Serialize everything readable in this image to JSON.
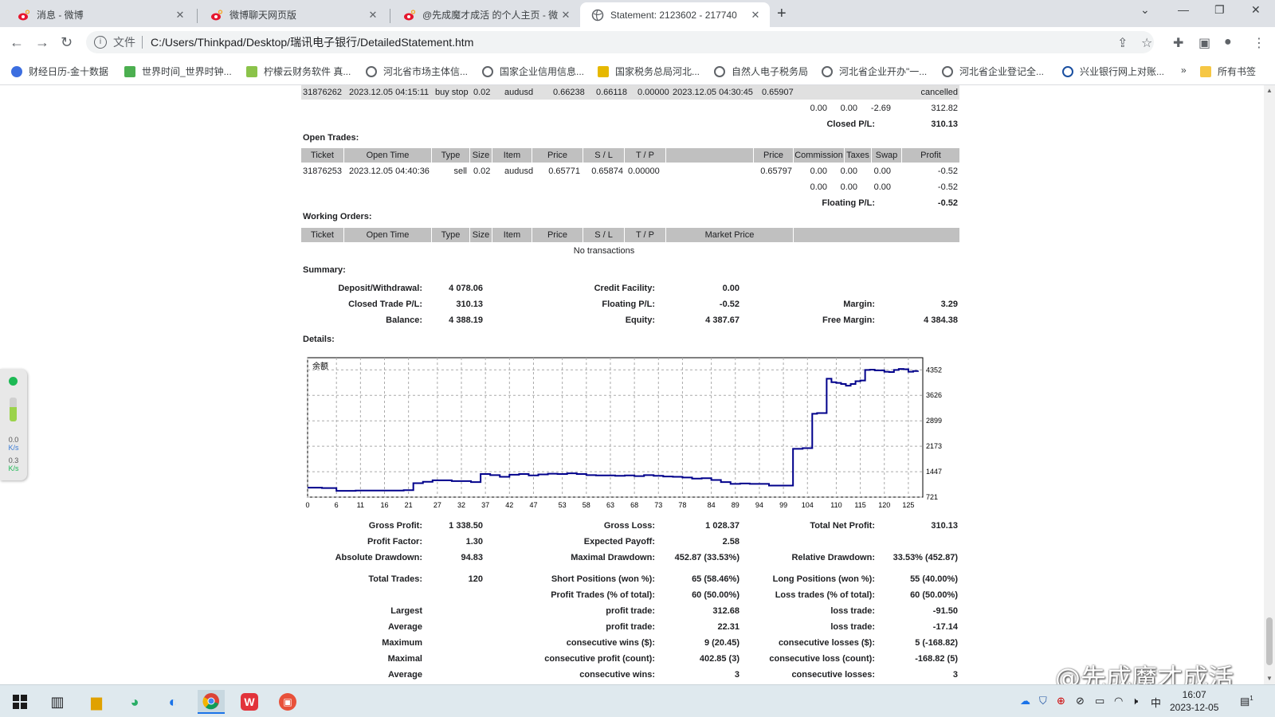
{
  "tabs": [
    {
      "title": "消息 - 微博",
      "icon": "weibo-icon"
    },
    {
      "title": "微博聊天网页版",
      "icon": "weibo-icon"
    },
    {
      "title": "@先成魔才成活 的个人主页 - 微",
      "icon": "weibo-icon"
    },
    {
      "title": "Statement: 2123602 - 217740",
      "icon": "globe-icon"
    }
  ],
  "address": {
    "file_label": "文件",
    "url": "C:/Users/Thinkpad/Desktop/瑞讯电子银行/DetailedStatement.htm"
  },
  "bookmarks": [
    {
      "label": "财经日历-金十数据",
      "color": "#3c6ee0"
    },
    {
      "label": "世界时间_世界时钟...",
      "color": "#4caf50"
    },
    {
      "label": "柠檬云财务软件 真...",
      "color": "#8bc34a"
    },
    {
      "label": "河北省市场主体信...",
      "color": "#5f6368"
    },
    {
      "label": "国家企业信用信息...",
      "color": "#5f6368"
    },
    {
      "label": "国家税务总局河北...",
      "color": "#e6b800"
    },
    {
      "label": "自然人电子税务局",
      "color": "#5f6368"
    },
    {
      "label": "河北省企业开办\"一...",
      "color": "#5f6368"
    },
    {
      "label": "河北省企业登记全...",
      "color": "#5f6368"
    },
    {
      "label": "兴业银行网上对账...",
      "color": "#1a4fa0"
    }
  ],
  "bookmarks_more": "»",
  "bookmarks_folder": "所有书签",
  "cancelled_row": {
    "ticket": "31876262",
    "time": "2023.12.05 04:15:11",
    "type": "buy stop",
    "size": "0.02",
    "item": "audusd",
    "price": "0.66238",
    "sl": "0.66118",
    "tp": "0.00000",
    "time2": "2023.12.05 04:30:45",
    "price2": "0.65907",
    "status": "cancelled"
  },
  "closed_totals": {
    "commission": "0.00",
    "taxes": "0.00",
    "swap": "-2.69",
    "profit": "312.82",
    "pl_label": "Closed P/L:",
    "pl_value": "310.13"
  },
  "open_trades": {
    "title": "Open Trades:",
    "headers": [
      "Ticket",
      "Open Time",
      "Type",
      "Size",
      "Item",
      "Price",
      "S / L",
      "T / P",
      "",
      "Price",
      "Commission",
      "Taxes",
      "Swap",
      "Profit"
    ],
    "row": {
      "ticket": "31876253",
      "time": "2023.12.05 04:40:36",
      "type": "sell",
      "size": "0.02",
      "item": "audusd",
      "price": "0.65771",
      "sl": "0.65874",
      "tp": "0.00000",
      "price2": "0.65797",
      "commission": "0.00",
      "taxes": "0.00",
      "swap": "0.00",
      "profit": "-0.52"
    },
    "totals": {
      "commission": "0.00",
      "taxes": "0.00",
      "swap": "0.00",
      "profit": "-0.52"
    },
    "floating_label": "Floating P/L:",
    "floating_value": "-0.52"
  },
  "working_orders": {
    "title": "Working Orders:",
    "headers": [
      "Ticket",
      "Open Time",
      "Type",
      "Size",
      "Item",
      "Price",
      "S / L",
      "T / P",
      "Market Price",
      ""
    ],
    "empty": "No transactions"
  },
  "summary": {
    "title": "Summary:",
    "deposit_label": "Deposit/Withdrawal:",
    "deposit": "4 078.06",
    "credit_label": "Credit Facility:",
    "credit": "0.00",
    "closed_label": "Closed Trade P/L:",
    "closed": "310.13",
    "floating_label": "Floating P/L:",
    "floating": "-0.52",
    "margin_label": "Margin:",
    "margin": "3.29",
    "balance_label": "Balance:",
    "balance": "4 388.19",
    "equity_label": "Equity:",
    "equity": "4 387.67",
    "free_margin_label": "Free Margin:",
    "free_margin": "4 384.38"
  },
  "details_title": "Details:",
  "chart_data": {
    "type": "line",
    "title": "",
    "corner_label": "余额",
    "xlabel": "",
    "ylabel": "",
    "x_ticks": [
      "0",
      "6",
      "11",
      "16",
      "21",
      "27",
      "32",
      "37",
      "42",
      "47",
      "53",
      "58",
      "63",
      "68",
      "73",
      "78",
      "84",
      "89",
      "94",
      "99",
      "104",
      "110",
      "115",
      "120",
      "125"
    ],
    "y_ticks": [
      "4352",
      "3626",
      "2899",
      "2173",
      "1447",
      "721"
    ],
    "ylim": [
      721,
      4700
    ],
    "xlim": [
      0,
      128
    ],
    "grid": true,
    "line_color": "#00008b",
    "series": [
      {
        "x": [
          0,
          3,
          6,
          8,
          10,
          14,
          20,
          22,
          24,
          26,
          30,
          34,
          36,
          38,
          40,
          42,
          44,
          46,
          48,
          50,
          52,
          54,
          56,
          58,
          60,
          62,
          64,
          66,
          68,
          70,
          72,
          74,
          76,
          78,
          80,
          82,
          84,
          86,
          88,
          90,
          92,
          94,
          96,
          100,
          101,
          103,
          104,
          105,
          106,
          107,
          108,
          109,
          110,
          111,
          112,
          113,
          114,
          115,
          116,
          117,
          118,
          119,
          120,
          121,
          122,
          123,
          124,
          125,
          126,
          127
        ],
        "y": [
          990,
          980,
          900,
          900,
          910,
          910,
          920,
          1120,
          1160,
          1200,
          1180,
          1150,
          1380,
          1350,
          1300,
          1360,
          1380,
          1340,
          1370,
          1390,
          1380,
          1400,
          1380,
          1350,
          1340,
          1340,
          1330,
          1340,
          1320,
          1350,
          1330,
          1310,
          1300,
          1280,
          1250,
          1260,
          1210,
          1150,
          1100,
          1110,
          1100,
          1100,
          1050,
          1050,
          2100,
          2120,
          2120,
          3100,
          3120,
          3120,
          4100,
          4000,
          3980,
          3950,
          3900,
          3950,
          4030,
          4050,
          4350,
          4360,
          4340,
          4340,
          4300,
          4290,
          4350,
          4380,
          4370,
          4300,
          4320,
          4330
        ]
      }
    ]
  },
  "stats": {
    "gross_profit_label": "Gross Profit:",
    "gross_profit": "1 338.50",
    "gross_loss_label": "Gross Loss:",
    "gross_loss": "1 028.37",
    "net_profit_label": "Total Net Profit:",
    "net_profit": "310.13",
    "profit_factor_label": "Profit Factor:",
    "profit_factor": "1.30",
    "expected_payoff_label": "Expected Payoff:",
    "expected_payoff": "2.58",
    "abs_dd_label": "Absolute Drawdown:",
    "abs_dd": "94.83",
    "max_dd_label": "Maximal Drawdown:",
    "max_dd": "452.87 (33.53%)",
    "rel_dd_label": "Relative Drawdown:",
    "rel_dd": "33.53% (452.87)",
    "total_trades_label": "Total Trades:",
    "total_trades": "120",
    "short_label": "Short Positions (won %):",
    "short": "65 (58.46%)",
    "long_label": "Long Positions (won %):",
    "long": "55 (40.00%)",
    "profit_trades_label": "Profit Trades (% of total):",
    "profit_trades": "60 (50.00%)",
    "loss_trades_label": "Loss trades (% of total):",
    "loss_trades": "60 (50.00%)",
    "largest_label": "Largest",
    "largest_profit_label": "profit trade:",
    "largest_profit": "312.68",
    "largest_loss_label": "loss trade:",
    "largest_loss": "-91.50",
    "average_label": "Average",
    "average_profit_label": "profit trade:",
    "average_profit": "22.31",
    "average_loss_label": "loss trade:",
    "average_loss": "-17.14",
    "maximum_label": "Maximum",
    "max_wins_label": "consecutive wins ($):",
    "max_wins": "9 (20.45)",
    "max_losses_label": "consecutive losses ($):",
    "max_losses": "5 (-168.82)",
    "maximal_label": "Maximal",
    "maxl_profit_label": "consecutive profit (count):",
    "maxl_profit": "402.85 (3)",
    "maxl_loss_label": "consecutive loss (count):",
    "maxl_loss": "-168.82 (5)",
    "avg2_label": "Average",
    "avg_wins_label": "consecutive wins:",
    "avg_wins": "3",
    "avg_losses_label": "consecutive losses:",
    "avg_losses": "3"
  },
  "widget": {
    "down": "0.0",
    "down_unit": "K/s",
    "up": "0.3",
    "up_unit": "K/s"
  },
  "taskbar": {
    "time": "16:07",
    "date": "2023-12-05",
    "ime": "中",
    "notif_count": "1"
  },
  "watermark": "@先成魔才成活"
}
